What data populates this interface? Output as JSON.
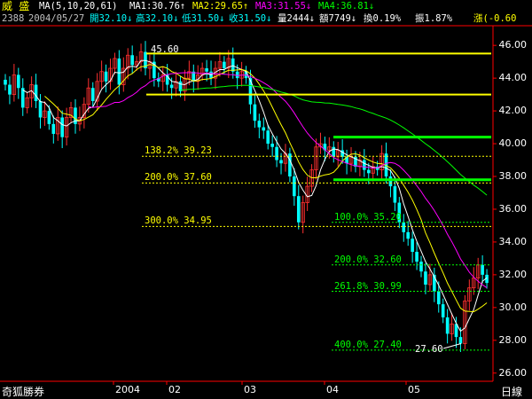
{
  "header": {
    "title": "威 盛",
    "ma_spec": "MA(5,10,20,61)",
    "ma1": "MA1:30.76↑",
    "ma2": "MA2:29.65↑",
    "ma3": "MA3:31.55↓",
    "ma4": "MA4:36.81↓",
    "code": "2388",
    "date": "2004/05/27",
    "open": "開32.10↓",
    "high": "高32.10↓",
    "low": "低31.50↓",
    "close": "收31.50↓",
    "volume": "量2444↓",
    "amount": "額7749↓",
    "turnover": "換0.19%",
    "amplitude": "振1.87%",
    "change": "漲(-0.60"
  },
  "footer": {
    "broker": "奇狐勝券",
    "period": "日線"
  },
  "colors": {
    "up": "#ff3030",
    "down": "#00ffff",
    "ma1": "#ffffff",
    "ma2": "#ffff00",
    "ma3": "#ff00ff",
    "ma4": "#00ff00",
    "resistance": "#ffff00",
    "channel": "#00ff00",
    "fib": "#ffff00",
    "fib2": "#00ff00",
    "grid": "#ff0000"
  },
  "chart_data": {
    "type": "candlestick",
    "ylim": [
      25.5,
      47.2
    ],
    "y_ticks": [
      "46.00",
      "44.00",
      "42.00",
      "40.00",
      "38.00",
      "36.00",
      "34.00",
      "32.00",
      "30.00",
      "28.00",
      "26.00"
    ],
    "x_ticks": [
      "2004",
      "02",
      "03",
      "04",
      "05"
    ],
    "annotations": [
      {
        "label": "45.60",
        "value": 45.6
      },
      {
        "label": "27.60",
        "value": 27.6
      }
    ],
    "horizontal_lines": [
      {
        "value": 45.5,
        "kind": "resistance"
      },
      {
        "value": 43.0,
        "kind": "resistance"
      },
      {
        "value": 40.4,
        "kind": "channel"
      },
      {
        "value": 37.8,
        "kind": "channel"
      }
    ],
    "fib_levels": [
      {
        "label": "138.2% 39.23",
        "value": 39.23,
        "group": "a"
      },
      {
        "label": "200.0% 37.60",
        "value": 37.6,
        "group": "a"
      },
      {
        "label": "300.0% 34.95",
        "value": 34.95,
        "group": "a"
      },
      {
        "label": "100.0% 35.20",
        "value": 35.2,
        "group": "b"
      },
      {
        "label": "200.0% 32.60",
        "value": 32.6,
        "group": "b"
      },
      {
        "label": "261.8% 30.99",
        "value": 30.99,
        "group": "b"
      },
      {
        "label": "400.0% 27.40",
        "value": 27.4,
        "group": "b"
      }
    ],
    "closes": [
      43.6,
      43.0,
      44.2,
      43.4,
      42.2,
      42.8,
      43.6,
      42.6,
      41.6,
      42.0,
      41.2,
      40.6,
      41.6,
      40.4,
      41.6,
      42.2,
      41.2,
      41.6,
      42.4,
      43.4,
      42.6,
      43.8,
      44.4,
      43.8,
      44.6,
      45.2,
      43.6,
      44.6,
      45.4,
      44.8,
      45.0,
      45.6,
      44.6,
      45.0,
      44.0,
      43.8,
      44.2,
      43.6,
      43.4,
      43.8,
      43.2,
      44.0,
      44.4,
      43.8,
      44.2,
      44.6,
      44.4,
      44.0,
      44.6,
      45.0,
      44.6,
      45.2,
      44.4,
      44.0,
      44.4,
      44.0,
      42.4,
      41.4,
      41.0,
      40.8,
      40.0,
      39.8,
      39.0,
      38.8,
      39.4,
      38.0,
      36.8,
      35.2,
      36.4,
      37.4,
      38.4,
      39.8,
      40.0,
      39.6,
      39.8,
      39.2,
      39.6,
      39.2,
      38.8,
      39.2,
      38.6,
      39.0,
      38.4,
      38.2,
      38.6,
      38.4,
      39.4,
      38.0,
      37.4,
      36.4,
      35.2,
      34.6,
      34.2,
      33.4,
      32.8,
      32.2,
      31.4,
      32.0,
      31.0,
      30.2,
      29.4,
      28.4,
      29.0,
      28.2,
      27.8,
      30.4,
      31.2,
      31.8,
      32.6,
      32.0,
      31.5
    ]
  }
}
